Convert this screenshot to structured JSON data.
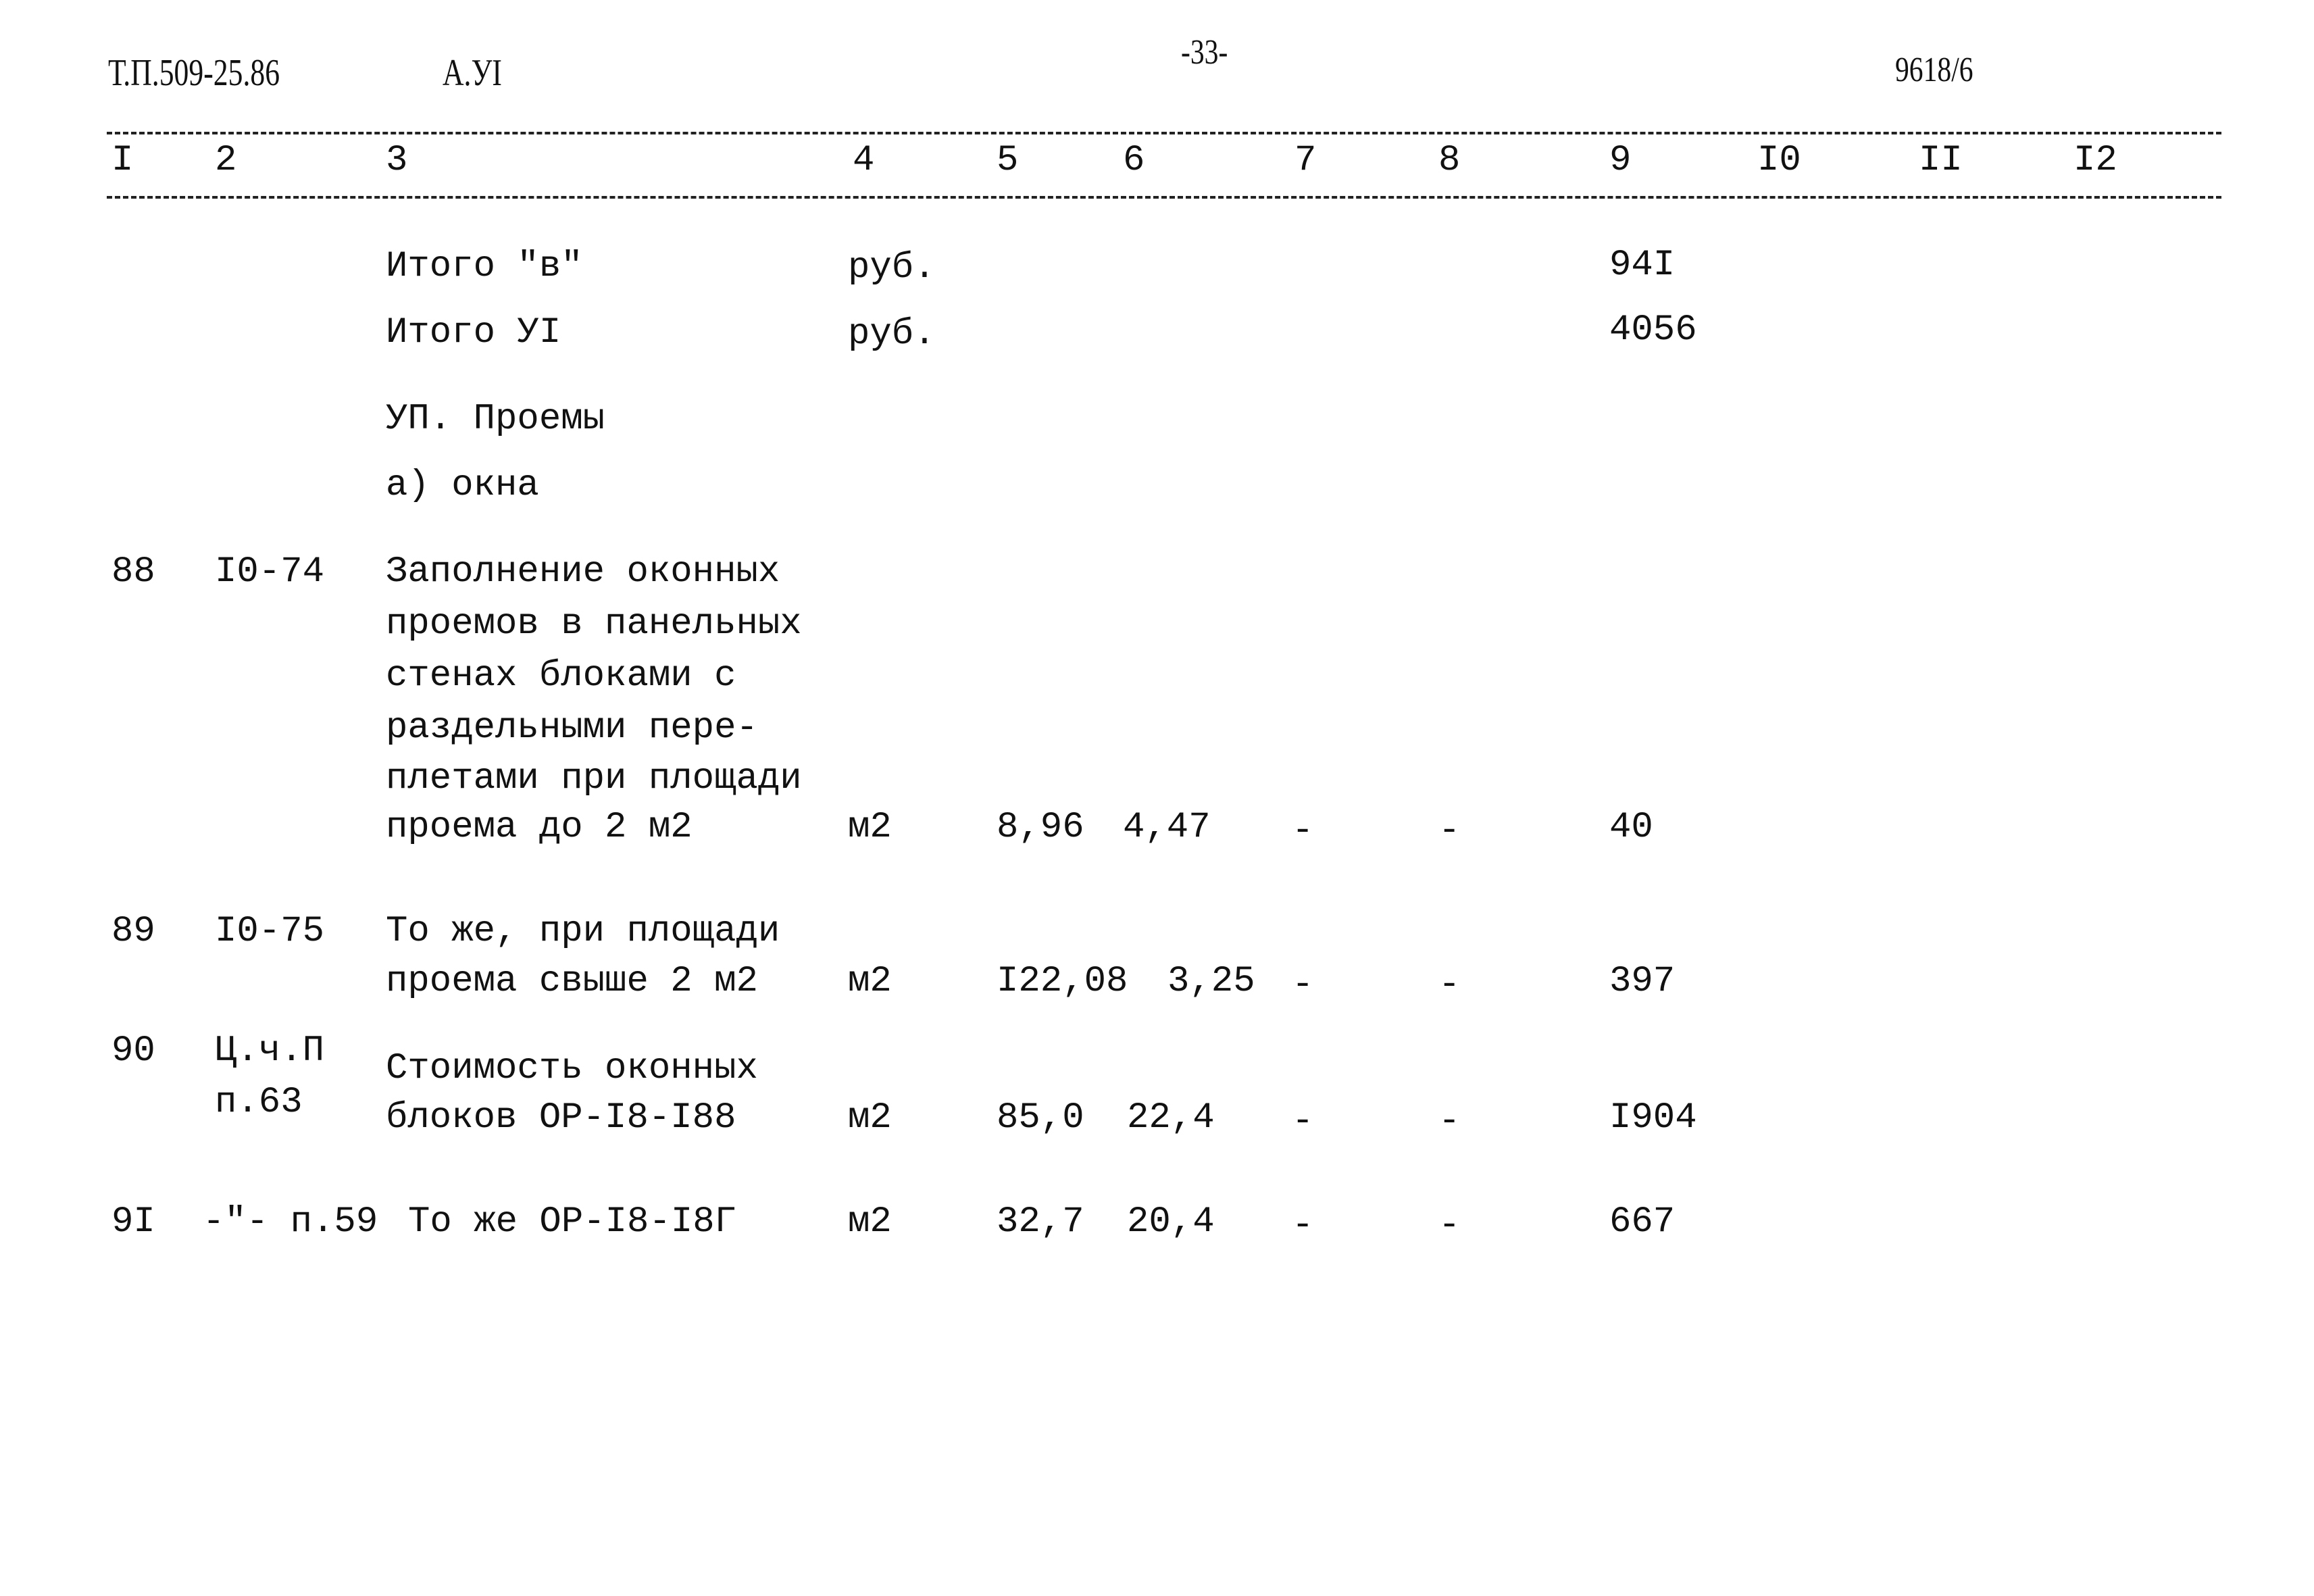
{
  "header": {
    "doc_code": "Т.П.509-25.86",
    "album": "А.УI",
    "page_number": "-33-",
    "inventory_number": "9618/6"
  },
  "columns": [
    "I",
    "2",
    "3",
    "4",
    "5",
    "6",
    "7",
    "8",
    "9",
    "I0",
    "II",
    "I2"
  ],
  "summary_rows": [
    {
      "label": "Итого \"в\"",
      "unit": "руб.",
      "col9": "94I"
    },
    {
      "label": "Итого УI",
      "unit": "руб.",
      "col9": "4056"
    }
  ],
  "section": {
    "title": "УП. Проемы",
    "subtitle": "а) окна"
  },
  "rows": [
    {
      "num": "88",
      "code_lines": [
        "I0-74"
      ],
      "desc_lines": [
        "Заполнение оконных",
        "проемов в панельных",
        "стенах блоками с",
        "раздельными пере-",
        "плетами при площади",
        "проема до 2 м2"
      ],
      "unit": "м2",
      "col5": "8,96",
      "col6": "4,47",
      "col7": "-",
      "col8": "-",
      "col9": "40"
    },
    {
      "num": "89",
      "code_lines": [
        "I0-75"
      ],
      "desc_lines": [
        "То же, при площади",
        "проема свыше 2 м2"
      ],
      "unit": "м2",
      "col5": "I22,08",
      "col6": "3,25",
      "col7": "-",
      "col8": "-",
      "col9": "397"
    },
    {
      "num": "90",
      "code_lines": [
        "Ц.ч.П",
        "п.63"
      ],
      "desc_lines": [
        "Стоимость оконных",
        "блоков ОР-I8-I88"
      ],
      "unit": "м2",
      "col5": "85,0",
      "col6": "22,4",
      "col7": "-",
      "col8": "-",
      "col9": "I904"
    },
    {
      "num": "9I",
      "code_lines": [
        "-\"- п.59"
      ],
      "desc_lines": [
        "То же ОР-I8-I8Г"
      ],
      "unit": "м2",
      "col5": "32,7",
      "col6": "20,4",
      "col7": "-",
      "col8": "-",
      "col9": "667"
    }
  ]
}
